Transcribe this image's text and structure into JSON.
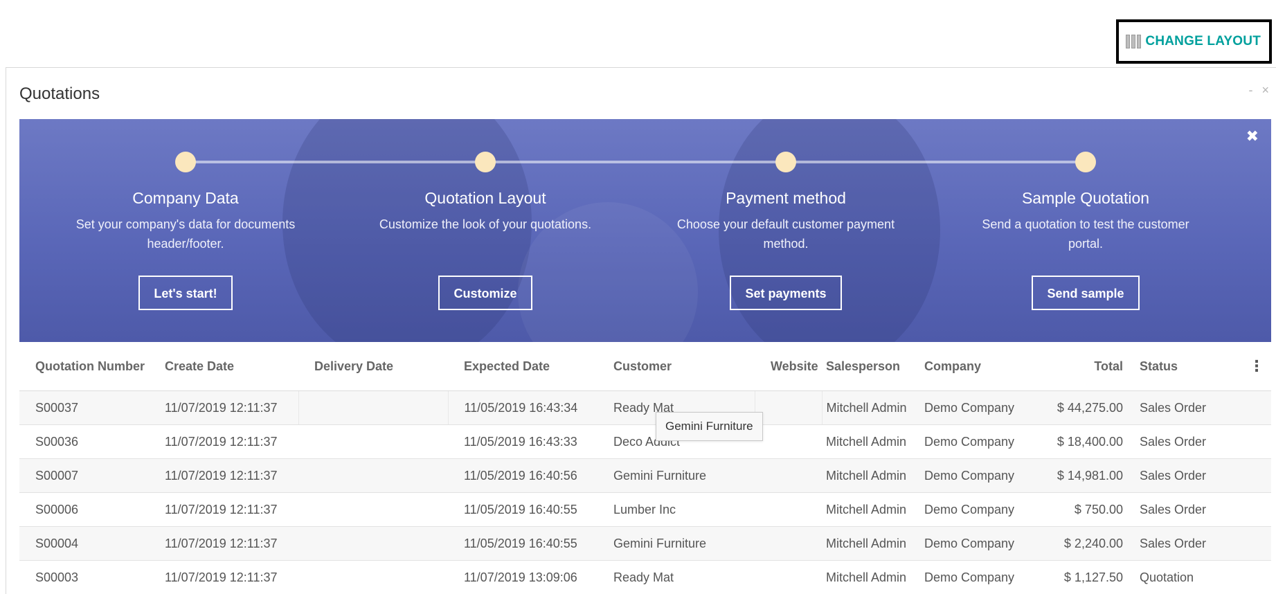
{
  "toolbar": {
    "change_layout_label": "CHANGE LAYOUT",
    "layout_icon": "layout-columns-icon"
  },
  "panel": {
    "title": "Quotations",
    "controls": "- ×"
  },
  "banner": {
    "close_glyph": "✖",
    "steps": [
      {
        "title": "Company Data",
        "description": "Set your company's data for documents header/footer.",
        "button": "Let's start!"
      },
      {
        "title": "Quotation Layout",
        "description": "Customize the look of your quotations.",
        "button": "Customize"
      },
      {
        "title": "Payment method",
        "description": "Choose your default customer payment method.",
        "button": "Set payments"
      },
      {
        "title": "Sample Quotation",
        "description": "Send a quotation to test the customer portal.",
        "button": "Send sample"
      }
    ]
  },
  "table": {
    "columns": [
      "Quotation Number",
      "Create Date",
      "Delivery Date",
      "Expected Date",
      "Customer",
      "Website",
      "Salesperson",
      "Company",
      "Total",
      "Status"
    ],
    "options_glyph": "⋮",
    "rows": [
      [
        "S00037",
        "11/07/2019 12:11:37",
        "",
        "11/05/2019 16:43:34",
        "Ready Mat",
        "",
        "Mitchell Admin",
        "Demo Company",
        "$ 44,275.00",
        "Sales Order"
      ],
      [
        "S00036",
        "11/07/2019 12:11:37",
        "",
        "11/05/2019 16:43:33",
        "Deco Addict",
        "",
        "Mitchell Admin",
        "Demo Company",
        "$ 18,400.00",
        "Sales Order"
      ],
      [
        "S00007",
        "11/07/2019 12:11:37",
        "",
        "11/05/2019 16:40:56",
        "Gemini Furniture",
        "",
        "Mitchell Admin",
        "Demo Company",
        "$ 14,981.00",
        "Sales Order"
      ],
      [
        "S00006",
        "11/07/2019 12:11:37",
        "",
        "11/05/2019 16:40:55",
        "Lumber Inc",
        "",
        "Mitchell Admin",
        "Demo Company",
        "$ 750.00",
        "Sales Order"
      ],
      [
        "S00004",
        "11/07/2019 12:11:37",
        "",
        "11/05/2019 16:40:55",
        "Gemini Furniture",
        "",
        "Mitchell Admin",
        "Demo Company",
        "$ 2,240.00",
        "Sales Order"
      ],
      [
        "S00003",
        "11/07/2019 12:11:37",
        "",
        "11/07/2019 13:09:06",
        "Ready Mat",
        "",
        "Mitchell Admin",
        "Demo Company",
        "$ 1,127.50",
        "Quotation"
      ]
    ]
  },
  "tooltip": {
    "text": "Gemini Furniture"
  },
  "colors": {
    "accent": "#00a09d",
    "banner": "#5a67b8",
    "dot": "#fbe7bd"
  }
}
